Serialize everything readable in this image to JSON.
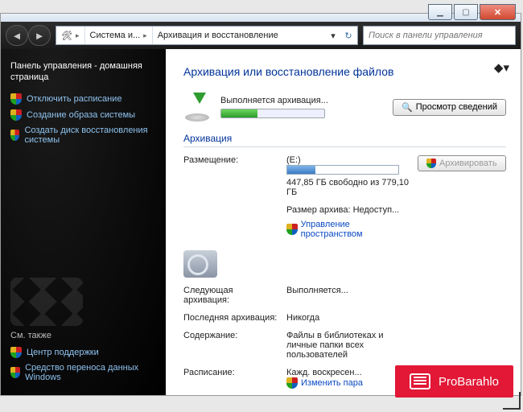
{
  "window": {
    "breadcrumb": [
      "Система и...",
      "Архивация и восстановление"
    ],
    "search_placeholder": "Поиск в панели управления"
  },
  "sidebar": {
    "home": "Панель управления - домашняя страница",
    "links": [
      "Отключить расписание",
      "Создание образа системы",
      "Создать диск восстановления системы"
    ],
    "see_also_heading": "См. также",
    "see_also": [
      "Центр поддержки",
      "Средство переноса данных Windows"
    ]
  },
  "content": {
    "title": "Архивация или восстановление файлов",
    "status_label": "Выполняется архивация...",
    "view_details_btn": "Просмотр сведений",
    "section_archive": "Архивация",
    "archive_btn": "Архивировать",
    "rows": {
      "location_k": "Размещение:",
      "location_v": "(E:)",
      "free_space": "447,85 ГБ свободно из 779,10 ГБ",
      "archive_size": "Размер архива: Недоступ...",
      "manage_space": "Управление пространством",
      "next_k": "Следующая архивация:",
      "next_v": "Выполняется...",
      "last_k": "Последняя архивация:",
      "last_v": "Никогда",
      "contents_k": "Содержание:",
      "contents_v": "Файлы в библиотеках и личные папки всех пользователей",
      "schedule_k": "Расписание:",
      "schedule_v": "Кажд. воскресен...",
      "change_params": "Изменить пара"
    }
  },
  "watermark": {
    "text": "ProBarahlo"
  }
}
